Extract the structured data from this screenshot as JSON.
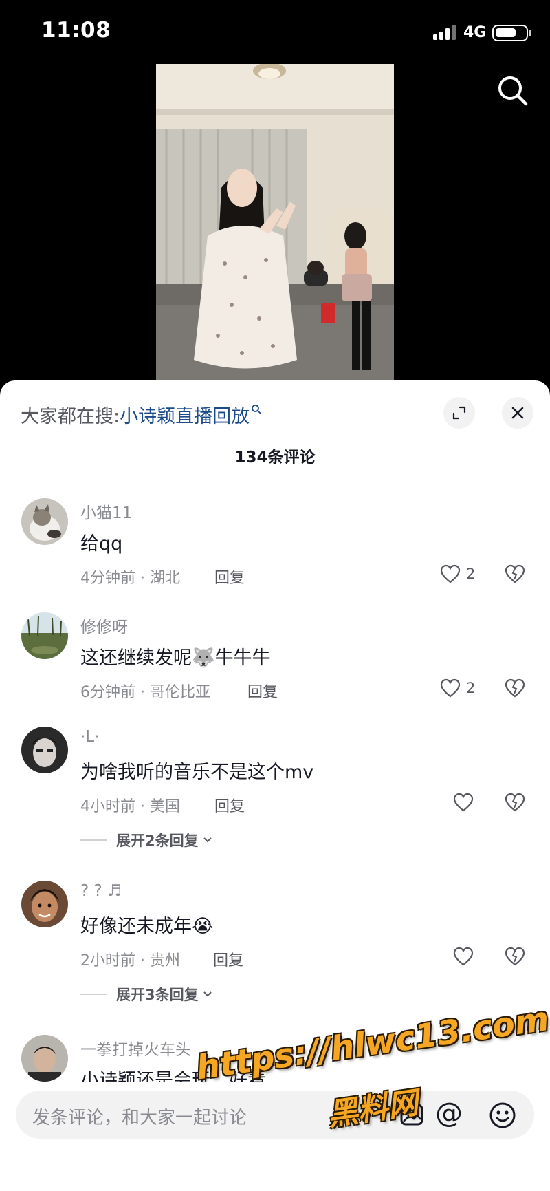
{
  "status_bar": {
    "time": "11:08",
    "network": "4G",
    "battery_level": 0.7
  },
  "hot_search": {
    "label": "大家都在搜:",
    "keyword": "小诗颖直播回放"
  },
  "comments_header": {
    "count_text": "134条评论"
  },
  "comments": [
    {
      "user": "小猫11",
      "text": "给qq",
      "meta": "4分钟前 · 湖北",
      "reply_label": "回复",
      "likes": "2",
      "avatar": "cat-avatar"
    },
    {
      "user": "修修呀",
      "text": "这还继续发呢🐺牛牛牛",
      "meta": "6分钟前 · 哥伦比亚",
      "reply_label": "回复",
      "likes": "2",
      "avatar": "landscape-avatar"
    },
    {
      "user": "·L·",
      "text": "为啥我听的音乐不是这个mv",
      "meta": "4小时前 · 美国",
      "reply_label": "回复",
      "likes": "",
      "expand": "展开2条回复",
      "avatar": "person-avatar"
    },
    {
      "user": "? ? ♬",
      "text": "好像还未成年😭",
      "meta": "2小时前 · 贵州",
      "reply_label": "回复",
      "likes": "",
      "expand": "展开3条回复",
      "avatar": "person-avatar"
    },
    {
      "user": "一拳打掉火车头",
      "text": "小诗颖还是会玩，好看",
      "meta": "",
      "reply_label": "",
      "likes": "",
      "avatar": "person-avatar"
    }
  ],
  "input_bar": {
    "placeholder": "发条评论，和大家一起讨论",
    "at_symbol": "@"
  },
  "watermark": {
    "url": "https://hlwc13.com",
    "name": "黑料网"
  },
  "colors": {
    "keyword": "#1c4b8a",
    "secondary_text": "#8a8b91",
    "watermark": "#f5a623"
  }
}
